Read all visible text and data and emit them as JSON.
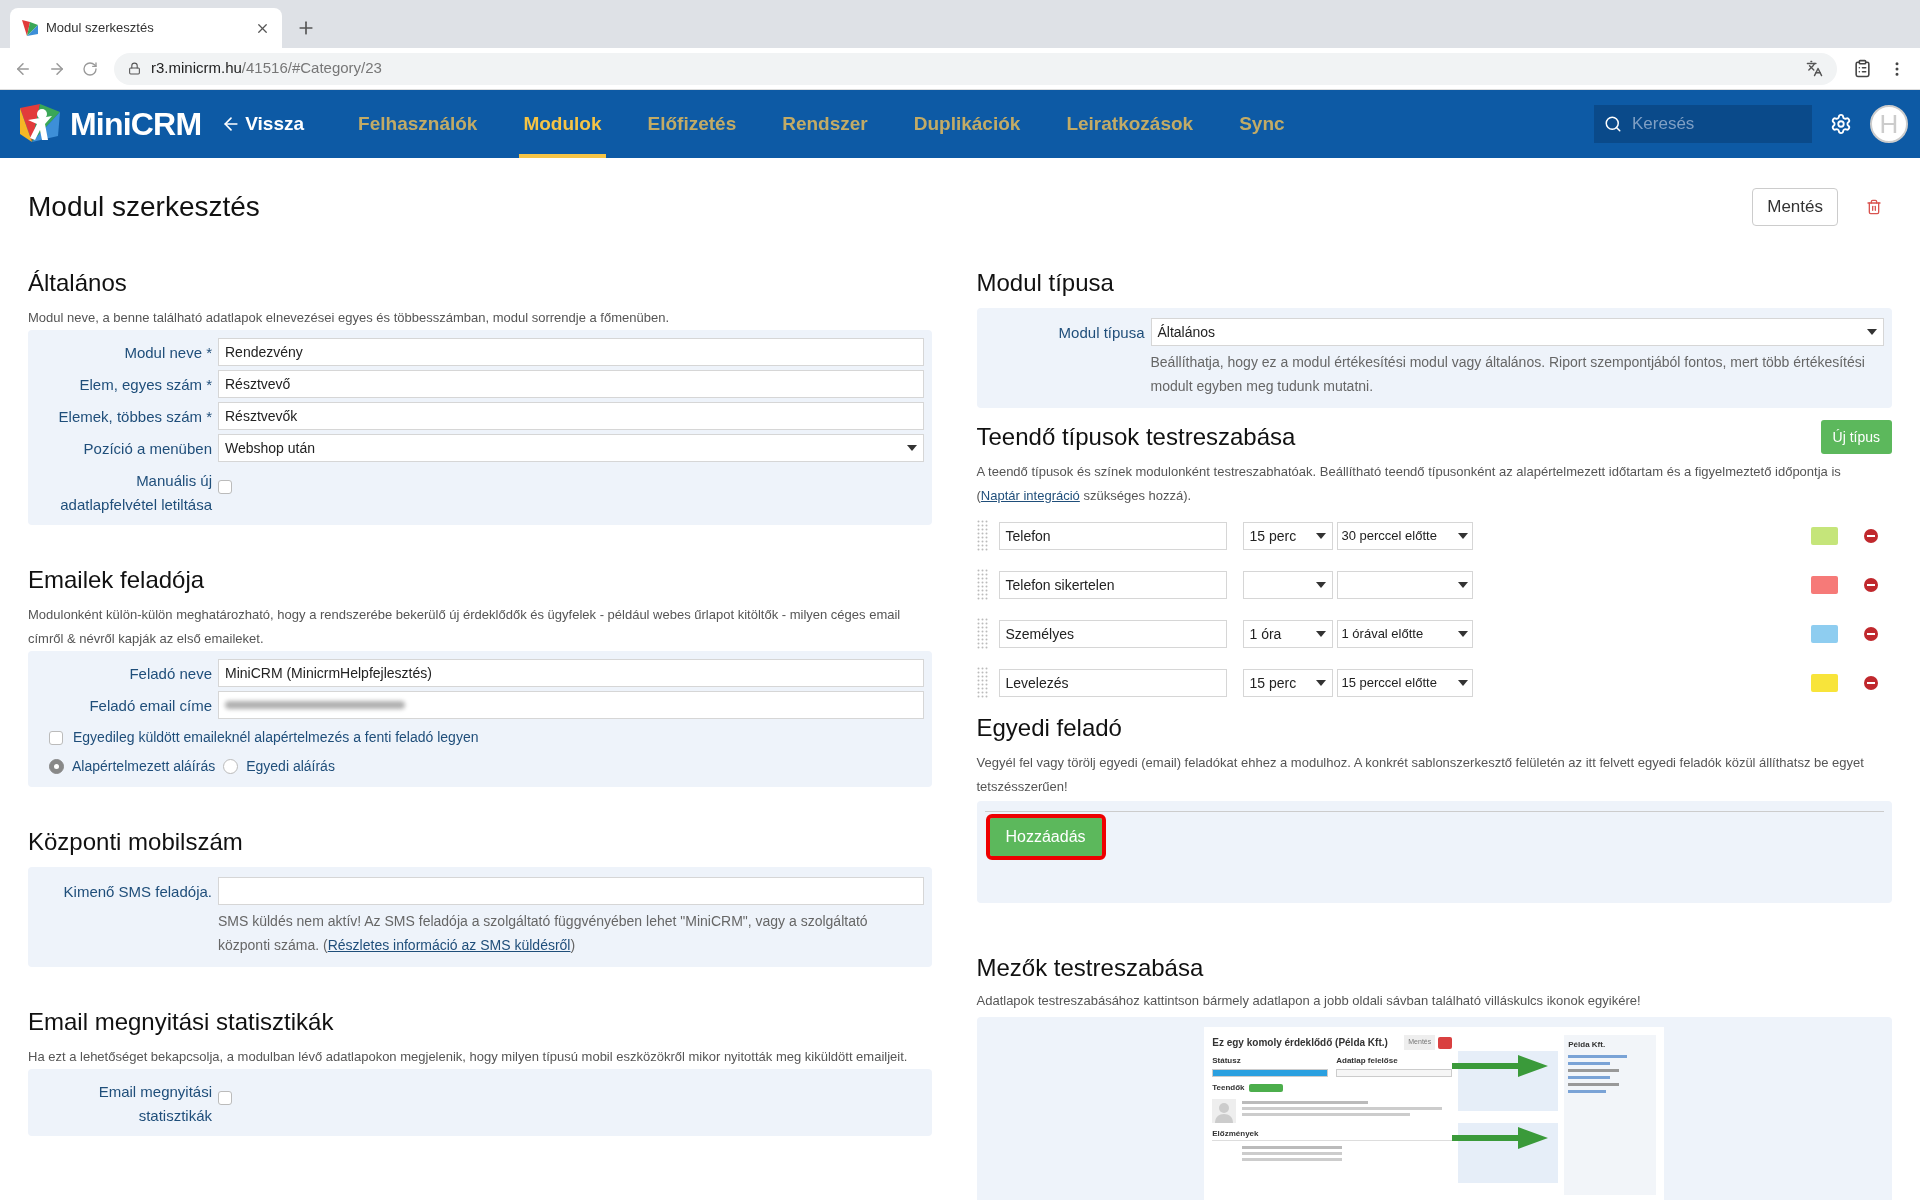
{
  "browser": {
    "tab_title": "Modul szerkesztés",
    "url_host": "r3.minicrm.hu",
    "url_path": "/41516/#Category/23"
  },
  "nav": {
    "logo": "MiniCRM",
    "back": "Vissza",
    "items": [
      {
        "label": "Felhasználók",
        "selected": false
      },
      {
        "label": "Modulok",
        "selected": true
      },
      {
        "label": "Előfizetés",
        "selected": false
      },
      {
        "label": "Rendszer",
        "selected": false
      },
      {
        "label": "Duplikációk",
        "selected": false
      },
      {
        "label": "Leiratkozások",
        "selected": false
      },
      {
        "label": "Sync",
        "selected": false
      }
    ],
    "search": {
      "placeholder": "Keresés"
    },
    "avatar_initial": "H"
  },
  "page": {
    "title": "Modul szerkesztés",
    "save": "Mentés"
  },
  "general": {
    "title": "Általános",
    "description": "Modul neve, a benne található adatlapok elnevezései egyes és többesszámban, modul sorrendje a főmenüben.",
    "fields": [
      {
        "label": "Modul neve *",
        "kind": "text",
        "value": "Rendezvény"
      },
      {
        "label": "Elem, egyes szám *",
        "kind": "text",
        "value": "Résztvevő"
      },
      {
        "label": "Elemek, többes szám *",
        "kind": "text",
        "value": "Résztvevők"
      },
      {
        "label": "Pozíció a menüben",
        "kind": "select",
        "value": "Webshop után"
      },
      {
        "label": "Manuális új adatlapfelvétel letiltása",
        "kind": "checkbox",
        "checked": false
      }
    ]
  },
  "sender": {
    "title": "Emailek feladója",
    "description": "Modulonként külön-külön meghatározható, hogy a rendszerébe bekerülő új érdeklődők és ügyfelek - például webes űrlapot kitöltők - milyen céges email címről & névről kapják az első emaileket.",
    "fields": [
      {
        "label": "Feladó neve",
        "kind": "text",
        "value": "MiniCRM (MinicrmHelpfejlesztés)"
      },
      {
        "label": "Feladó email címe",
        "kind": "blurred"
      }
    ],
    "default_checkbox": {
      "label": "Egyedileg küldött emaileknél alapértelmezés a fenti feladó legyen",
      "checked": false
    },
    "signatures": [
      {
        "label": "Alapértelmezett aláírás",
        "selected": true
      },
      {
        "label": "Egyedi aláírás",
        "selected": false
      }
    ]
  },
  "mobile": {
    "title": "Központi mobilszám",
    "label": "Kimenő SMS feladója.",
    "note": "SMS küldés nem aktív!  Az SMS feladója a szolgáltató függvényében lehet \"MiniCRM\", vagy a szolgáltató központi száma. (",
    "link": "Részletes információ az SMS küldésről",
    "note_end": ")"
  },
  "stats": {
    "title": "Email megnyitási statisztikák",
    "description": "Ha ezt a lehetőséget bekapcsolja, a modulban lévő adatlapokon megjelenik, hogy milyen típusú mobil eszközökről mikor nyitották meg kiküldött emailjeit.",
    "label": "Email megnyitási statisztikák",
    "checked": false
  },
  "module_type": {
    "title": "Modul típusa",
    "label": "Modul típusa",
    "value": "Általános",
    "note": "Beállíthatja, hogy ez a modul értékesítési modul vagy általános. Riport szempontjából fontos, mert több értékesítési modult egyben meg tudunk mutatni."
  },
  "task_types": {
    "title": "Teendő típusok testreszabása",
    "button": "Új típus",
    "description": "A teendő típusok és színek modulonként testreszabhatóak. Beállítható teendő típusonként az alapértelmezett időtartam és a figyelmeztető időpontja is (",
    "link": "Naptár integráció",
    "description_end": " szükséges hozzá).",
    "rows": [
      {
        "name": "Telefon",
        "duration": "15 perc",
        "reminder": "30 perccel előtte",
        "color": "#c5e57a"
      },
      {
        "name": "Telefon sikertelen",
        "color": "#f67a78"
      },
      {
        "name": "Személyes",
        "duration": "1 óra",
        "reminder": "1 órával előtte",
        "color": "#8ecdf0"
      },
      {
        "name": "Levelezés",
        "duration": "15 perc",
        "reminder": "15 perccel előtte",
        "color": "#f8e43a"
      }
    ]
  },
  "custom_sender": {
    "title": "Egyedi feladó",
    "description": "Vegyél fel vagy törölj egyedi (email) feladókat ehhez a modulhoz. A konkrét sablonszerkesztő felületén az itt felvett egyedi feladók közül állíthatsz be egyet tetszésszerűen!",
    "button": "Hozzáadás",
    "highlighted": true
  },
  "fields_custom": {
    "title": "Mezők testreszabása",
    "description": "Adatlapok testreszabásához kattintson bármely adatlapon a jobb oldali sávban található villáskulcs ikonok egyikére!",
    "screenshot": {
      "title": "Ez egy komoly érdeklődő (Példa Kft.)",
      "save": "Mentés",
      "labels": [
        "Státusz",
        "Adatlap felelőse"
      ],
      "todo": "Teendők",
      "history": "Előzmények",
      "company": "Példa Kft."
    }
  }
}
